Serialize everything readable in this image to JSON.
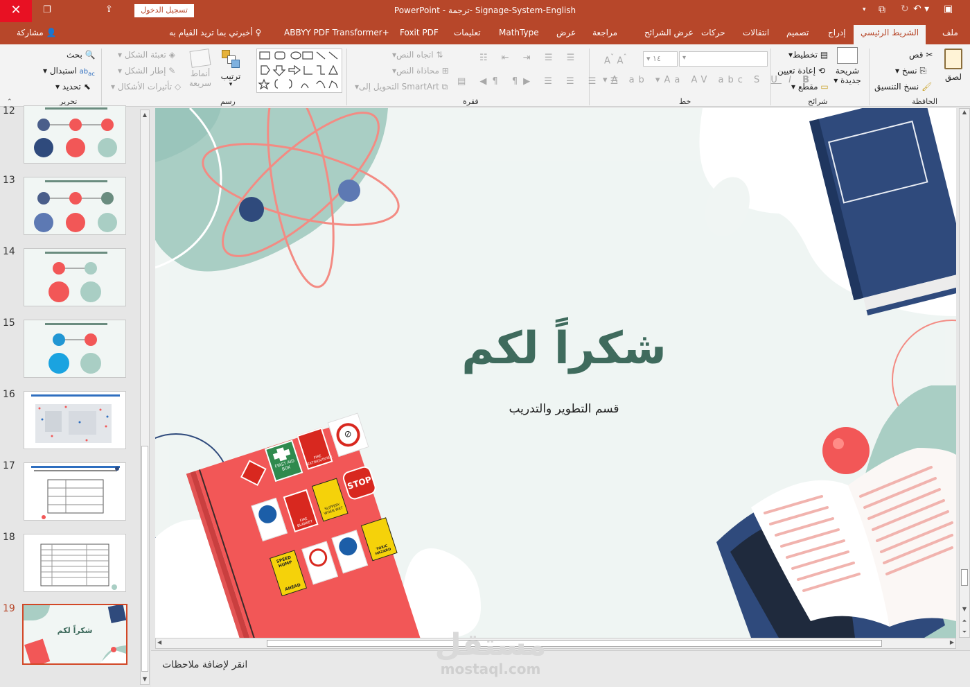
{
  "window": {
    "app": "PowerPoint",
    "doc_title": "ترجمة- Signage-System-English",
    "signin": "تسجيل الدخول"
  },
  "tabs": {
    "file": "ملف",
    "home": "الشريط الرئيسي",
    "insert": "إدراج",
    "design": "تصميم",
    "transitions": "انتقالات",
    "animations": "حركات",
    "slideshow": "عرض الشرائح",
    "review": "مراجعة",
    "view": "عرض",
    "mathtype": "MathType",
    "help": "تعليمات",
    "foxit": "Foxit PDF",
    "abbyy": "ABBYY PDF Transformer+",
    "tellme": "أخبرني بما تريد القيام به",
    "share": "مشاركة"
  },
  "ribbon": {
    "clipboard": {
      "paste": "لصق",
      "cut": "قص",
      "copy": "نسخ",
      "format_painter": "نسخ التنسيق",
      "group": "الحافظة"
    },
    "slides": {
      "new_slide": "شريحة",
      "new_slide2": "جديدة",
      "layout": "تخطيط",
      "reset": "إعادة تعيين",
      "section": "مقطع",
      "group": "شرائح"
    },
    "font": {
      "size": "١٤",
      "group": "خط"
    },
    "paragraph": {
      "text_direction": "اتجاه النص",
      "align_text": "محاذاة النص",
      "smartart": "التحويل إلى SmartArt",
      "group": "فقرة"
    },
    "drawing": {
      "arrange": "ترتيب",
      "styles": "أنماط",
      "styles2": "سريعة",
      "fill": "تعبئة الشكل",
      "outline": "إطار الشكل",
      "effects": "تأثيرات الأشكال",
      "group": "رسم"
    },
    "editing": {
      "find": "بحث",
      "replace": "استبدال",
      "select": "تحديد",
      "group": "تحرير"
    }
  },
  "thumbnails": [
    {
      "num": "12"
    },
    {
      "num": "13"
    },
    {
      "num": "14"
    },
    {
      "num": "15"
    },
    {
      "num": "16"
    },
    {
      "num": "17"
    },
    {
      "num": "18"
    },
    {
      "num": "19",
      "label": "شكراً لكم"
    }
  ],
  "slide": {
    "title": "شكراً لكم",
    "subtitle": "قسم التطوير والتدريب"
  },
  "signs": {
    "first_aid": "FIRST AID BOX",
    "fire_ext": "FIRE EXTINGUISHER",
    "fire_blanket": "FIRE BLANKET",
    "slippery": "SLIPPERY WHEN WET",
    "stop": "STOP",
    "speed": "SPEED HUMP",
    "ahead": "AHEAD",
    "toxic": "TOXIC HAZARD"
  },
  "notes": {
    "placeholder": "انقر لإضافة ملاحظات"
  },
  "watermark": {
    "arabic": "مستقل",
    "latin": "mostaql.com"
  },
  "colors": {
    "accent": "#b7472a",
    "title": "#3f6b5d",
    "teal": "#a9cec4",
    "red": "#f25757",
    "navy": "#2f4a7c"
  }
}
